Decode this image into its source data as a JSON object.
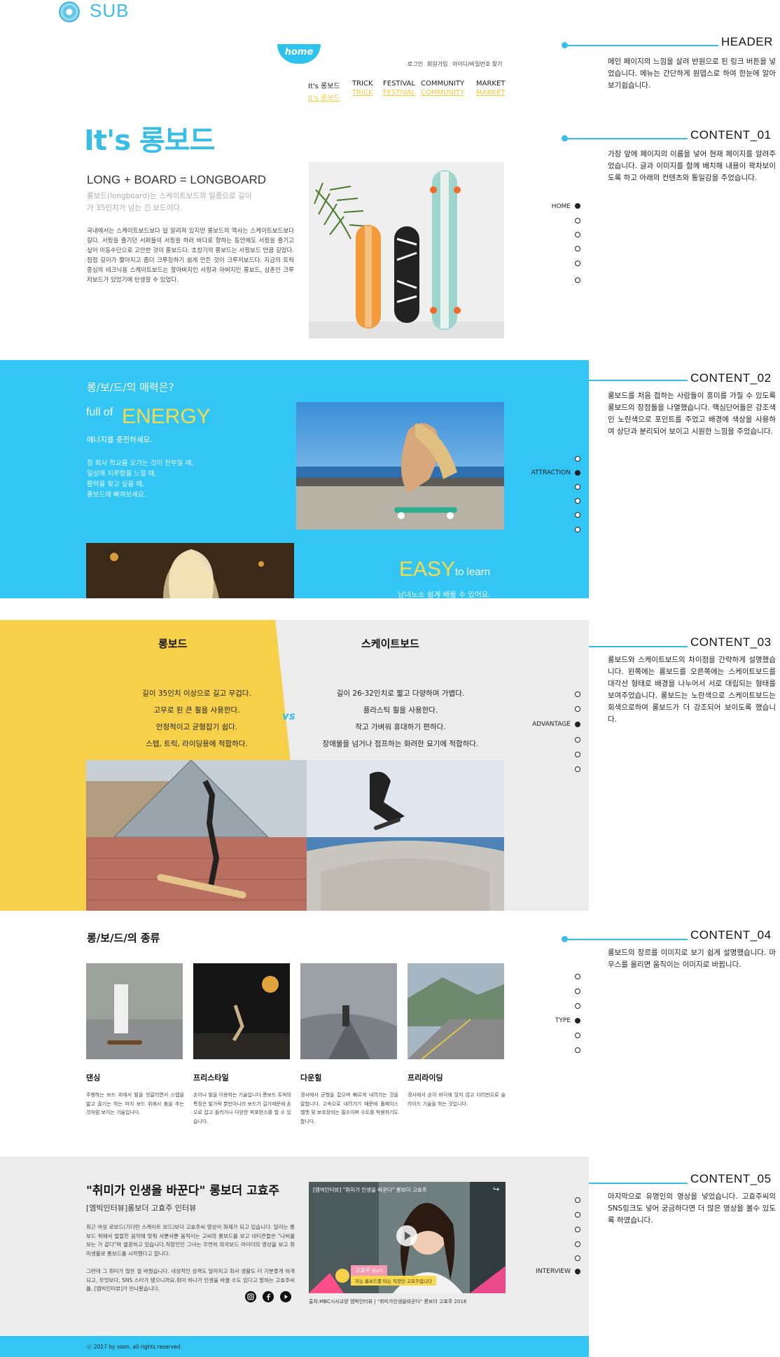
{
  "sub": {
    "label": "SUB"
  },
  "header": {
    "home_tab": "home",
    "util": [
      "로그인",
      "회원가입",
      "아이디/비밀번호 찾기"
    ],
    "gnb": [
      {
        "main": "It's 롱보드",
        "sub": "It's 롱보드"
      },
      {
        "main": "TRICK",
        "sub": "TRICK"
      },
      {
        "main": "FESTIVAL",
        "sub": "FESTIVAL"
      },
      {
        "main": "COMMUNITY",
        "sub": "COMMUNITY"
      },
      {
        "main": "MARKET",
        "sub": "MARKET"
      }
    ]
  },
  "annotations": [
    {
      "title": "HEADER",
      "text": "메인 페이지의 느낌을 살려 반원으로 된 링크 버튼을 넣었습니다. 메뉴는 간단하게 원뎁스로 하여 한눈에 알아보기쉽습니다."
    },
    {
      "title": "CONTENT_01",
      "text": "가장 앞에 페이지의 이름을 넣어 현재 페이지를 알려주었습니다. 글과 이미지를 함께 배치해 내용이 꽉차보이도록 하고 아래의 컨텐츠와 통일감을 주었습니다."
    },
    {
      "title": "CONTENT_02",
      "text": "롱보드를 처음 접하는 사람들이 흥미를 가질 수 있도록 롱보드의 장점들을 나열했습니다. 핵심단어들은 강조색인 노란색으로 포인트를 주었고 배경에 색상을 사용하여 상단과 분리되어 보이고 시원한 느낌을 주었습니다."
    },
    {
      "title": "CONTENT_03",
      "text": "롱보드와 스케이트보드의 차이점을 간략하게 설명했습니다. 왼쪽에는 롱보드를 오른쪽에는 스케이트보드를 대각선 형태로 배경을 나누어서 서로 대립되는 형태를 보여주었습니다. 롱보드는 노란색으로 스케이트보드는 회색으로하여 롱보드가 더 강조되어 보이도록 했습니다."
    },
    {
      "title": "CONTENT_04",
      "text": "롱보드의 장르를 이미지로 보기 쉽게 설명했습니다. 마우스를 올리면 움직이는 이미지로 바뀝니다."
    },
    {
      "title": "CONTENT_05",
      "text": "마지막으로 유명인의 영상을 넣었습니다. 고효주씨의 SNS링크도 넣어 궁금하다면 더 많은 영상을 볼수 있도록 하였습니다."
    }
  ],
  "side_nav_labels": [
    "HOME",
    "ATTRACTION",
    "ADVANTAGE",
    "TYPE",
    "INTERVIEW"
  ],
  "content1": {
    "title": "It's 롱보드",
    "subtitle": "LONG + BOARD = LONGBOARD",
    "desc": "롱보드(longboard)는 스케이트보드의 일종으로 길이가 35인치가 넘는 긴 보드이다.",
    "body": "국내에서는 스케이트보드보다 덜 알려져 있지만 롱보드의 역사는 스케이트보드보다 길다. 서핑을 즐기던 서퍼들이 서핑을 하러 바다로 향하는 동안에도 서핑을 즐기고 싶어 이동수단으로 고안한 것이 롱보드다. 초창기의 롱보드는 서핑보드 만큼 길었다. 점점 길이가 짧아지고 좀더 크루징하기 쉽게 만든 것이 크루저보드다. 지금의 트릭 중심의 테크닉용 스케이트보드는 할아버지인 서핑과 아버지인 롱보드, 삼촌인 크루저보드가 있었기에 탄생할 수 있었다."
  },
  "content2": {
    "question": "롱/보/드/의 매력은?",
    "full_of": "full of",
    "energy": "ENERGY",
    "fill": "에너지를 충전하세요.",
    "list": [
      "집 회사 학교를 오가는 것이 전부일 때,",
      "일상에 지루함을 느낄 때,",
      "활력을 찾고 싶을 때,",
      "롱보드에 빠져보세요."
    ],
    "easy": "EASY",
    "to_learn": "to learn",
    "easy_desc": "남녀노소 쉽게 배울 수 있어요."
  },
  "content3": {
    "left_title": "롱보드",
    "right_title": "스케이트보드",
    "vs": "vs",
    "left_lines": [
      "길이 35인치 이상으로 길고 무겁다.",
      "고무로 된 큰 휠을 사용한다.",
      "안정적이고 균형잡기 쉽다.",
      "스텝, 트릭, 라이딩용에 적합하다."
    ],
    "right_lines": [
      "길이 26-32인치로 짧고 다양하며 가볍다.",
      "플라스틱 휠을 사용한다.",
      "작고 가벼워 휴대하기 편하다.",
      "장애물을 넘거나 점프하는 화려한 묘기에 적합하다."
    ]
  },
  "content4": {
    "title": "롱/보/드/의 종류",
    "cards": [
      {
        "name": "댄싱",
        "desc": "주행하는 보드 위에서 발을 엇갈리면서 스텝을 밟고 즐기는 하는 마치 보드 위에서 춤을 추는 것처럼 보이는 기술입니다."
      },
      {
        "name": "프리스타일",
        "desc": "손이나 발을 이용하는 기술입니다.롱보드 트릭의 특징은 발가락 뿐만아니라 보드가 길기때문에 손으로 잡고 돌리거나 다양한 퍼포먼스를 할 수 있습니다."
      },
      {
        "name": "다운힐",
        "desc": "경사에서 균형을 잡으며 빠르게 내려가는 것을 말합니다. 고속으로 내려가기 때문에 풀페이스 헬멧 및 보호장비는 필수이며 수트를 착용하기도 합니다."
      },
      {
        "name": "프리라이딩",
        "desc": "경사에서 손이 바닥에 닿지 않고 다리만으로 슬라이드 기술을 하는 것입니다."
      }
    ]
  },
  "content5": {
    "title": "\"취미가 인생을 바꾼다\" 롱보더 고효주",
    "subtitle": "[엠빅인터뷰]롱보더 고효주 인터뷰",
    "body1": "최근 여성 로보드(기다란 스케이트 보드)보더 고효주씨 영상이 화제가 되고 있습니다. 달리는 롱보드 위에서 발랄한 음악에 맞춰 사뿐사뿐 움직이는 고씨의 롱보드를 보고 네티즌들은 \"나비를 보는 거 같다\"며 열광하고 있습니다.직장인인 그녀는 우연히 외국보드 라이더의 영상을 보고 취미생활로 롱보드를 시작했다고 합니다.",
    "body2": "그런데 그 취미가 많은 걸 바꿨습니다. 내성적인 성격도 달라지고 회사 생활도 더 기분좋게 하게되고, 무엇보다, SNS 스타가 됐으니까요.취미 하나가 인생을 바꿀 수도 있다고 말하는 고효주씨를, [엠빅인터뷰]가 만나봤습니다.",
    "video_title": "[엠빅인터뷰] \"취미가 인생을 바꾼다\" 롱보더 고효주",
    "video_name": "고효주",
    "video_name_sub": "롱보더",
    "video_caption_line": "저는 롱보드를 타는 직장인 고효주입니다",
    "caption": "출처:MBC시사교양 엠빅인터뷰 | \"취미가인생을바꾼다\" 롱보더 고효주 2016",
    "sns": [
      "instagram-icon",
      "facebook-icon",
      "youtube-icon"
    ]
  },
  "footer": {
    "text": "ⓒ 2017 by soon. all rights reserved."
  },
  "colors": {
    "accent": "#33c5f3",
    "yellow": "#f7d04a",
    "gray": "#ececec"
  }
}
